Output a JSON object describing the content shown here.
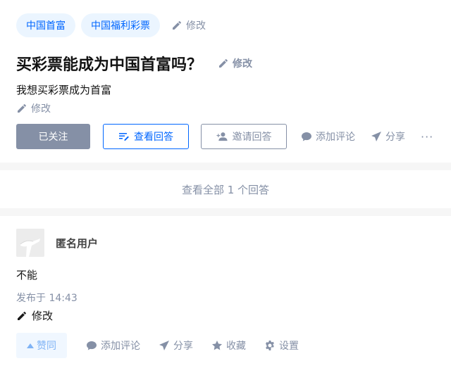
{
  "question": {
    "topics": [
      "中国首富",
      "中国福利彩票"
    ],
    "topics_edit_label": "修改",
    "title": "买彩票能成为中国首富吗？",
    "title_edit_label": "修改",
    "detail": "我想买彩票成为首富",
    "detail_edit_label": "修改",
    "actions": {
      "follow_label": "已关注",
      "view_answers_label": "查看回答",
      "invite_label": "邀请回答",
      "comment_label": "添加评论",
      "share_label": "分享",
      "more_label": "···"
    }
  },
  "view_all": {
    "label": "查看全部 1 个回答"
  },
  "answer": {
    "author_name": "匿名用户",
    "content": "不能",
    "published": "发布于 14:43",
    "edit_label": "修改",
    "actions": {
      "vote_label": "赞同",
      "comment_label": "添加评论",
      "share_label": "分享",
      "collect_label": "收藏",
      "settings_label": "设置"
    }
  },
  "colors": {
    "brand": "#0066ff",
    "muted": "#8590a6",
    "followed_bg": "#8590a6",
    "topic_bg": "#ebf5ff",
    "vote_bg": "#f0f7ff"
  },
  "icons": [
    "pencil-icon",
    "view-answer-icon",
    "invite-user-icon",
    "comment-icon",
    "share-icon",
    "star-icon",
    "gear-icon",
    "vote-up-icon"
  ]
}
